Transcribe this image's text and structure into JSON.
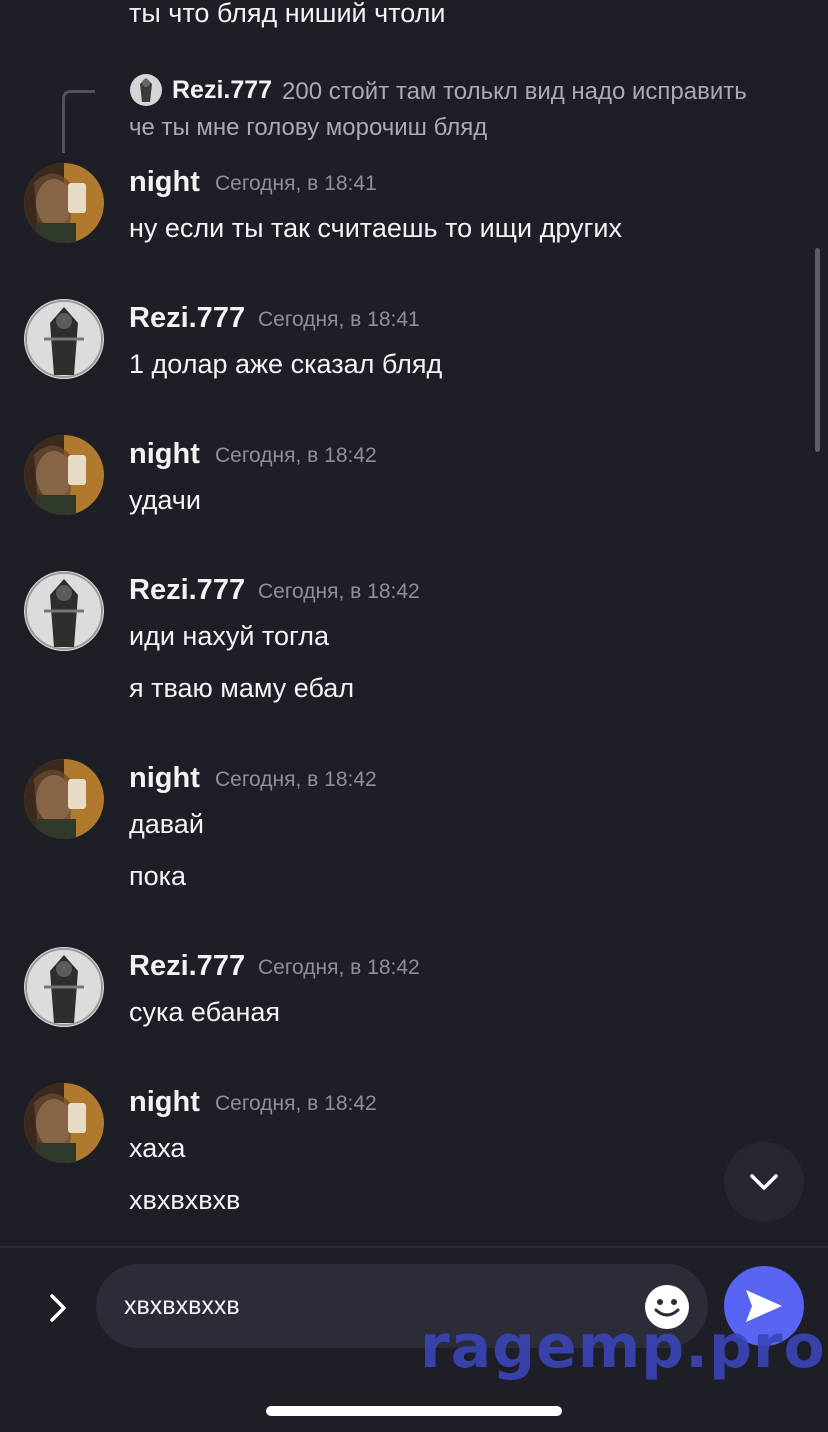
{
  "top_partial_message": "ты что бляд ниший чтоли",
  "reply": {
    "author": "Rezi.777",
    "text_line1": "200 стойт там толькл вид надо исправить",
    "text_line2": "че ты мне голову морочиш бляд"
  },
  "messages": [
    {
      "author": "night",
      "time": "Сегодня, в 18:41",
      "lines": [
        "ну если ты так считаешь то ищи других"
      ]
    },
    {
      "author": "Rezi.777",
      "time": "Сегодня, в 18:41",
      "lines": [
        "1 долар аже сказал бляд"
      ]
    },
    {
      "author": "night",
      "time": "Сегодня, в 18:42",
      "lines": [
        "удачи"
      ]
    },
    {
      "author": "Rezi.777",
      "time": "Сегодня, в 18:42",
      "lines": [
        "иди нахуй тогла",
        "я тваю маму ебал"
      ]
    },
    {
      "author": "night",
      "time": "Сегодня, в 18:42",
      "lines": [
        "давай",
        "пока"
      ]
    },
    {
      "author": "Rezi.777",
      "time": "Сегодня, в 18:42",
      "lines": [
        "сука ебаная"
      ]
    },
    {
      "author": "night",
      "time": "Сегодня, в 18:42",
      "lines": [
        "хаха",
        "хвхвхвхв"
      ]
    }
  ],
  "composer": {
    "value": "хвхвхвххв",
    "expand_icon": "chevron-right-icon",
    "emoji_icon": "smiley-icon",
    "send_icon": "send-arrow-icon"
  },
  "scroll_down_icon": "chevron-down-icon",
  "watermark": "ragemp.pro",
  "colors": {
    "background": "#1d1e26",
    "accent": "#5865f2",
    "timestamp": "#8e9098",
    "input_bg": "#2b2c38"
  }
}
